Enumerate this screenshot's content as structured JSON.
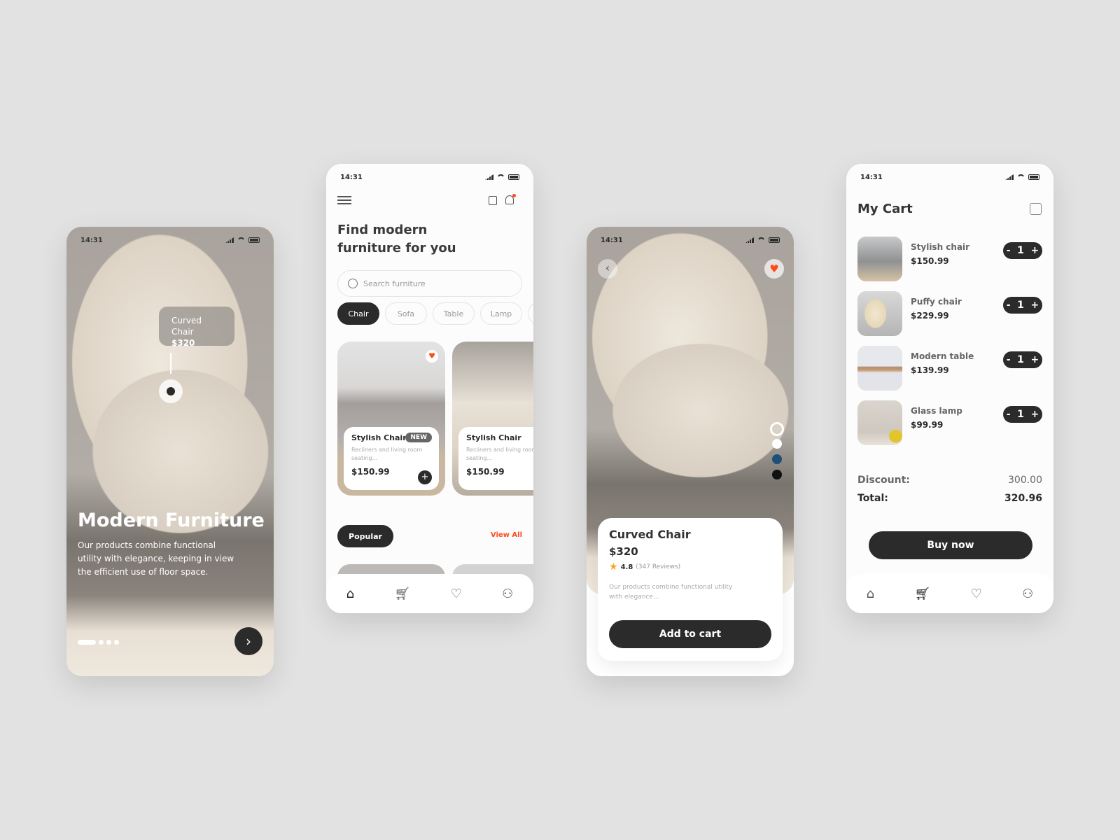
{
  "status_time": "14:31",
  "onboarding": {
    "tag_name": "Curved Chair",
    "tag_price": "$320",
    "title": "Modern Furniture",
    "description": "Our products combine functional utility with elegance, keeping in view the efficient use of floor space.",
    "page_index": 1,
    "page_count": 4
  },
  "home": {
    "title_line1": "Find modern",
    "title_line2": "furniture for you",
    "search_placeholder": "Search furniture",
    "categories": [
      "Chair",
      "Sofa",
      "Table",
      "Lamp"
    ],
    "selected_category": "Chair",
    "products": [
      {
        "name": "Stylish Chair",
        "badge": "NEW",
        "desc": "Recliners and living room seating...",
        "price": "$150.99"
      },
      {
        "name": "Stylish Chair",
        "desc": "Recliners and living room seating...",
        "price": "$150.99"
      }
    ],
    "popular_label": "Popular",
    "view_all": "View All"
  },
  "detail": {
    "name": "Curved Chair",
    "price": "$320",
    "rating": "4.8",
    "reviews": "(347 Reviews)",
    "description": "Our products combine functional utility with elegance...",
    "add_to_cart": "Add to cart",
    "colors": [
      "#d9d2c6",
      "#ffffff",
      "#1f4e79",
      "#111111"
    ]
  },
  "cart": {
    "title": "My Cart",
    "items": [
      {
        "name": "Stylish chair",
        "price": "$150.99",
        "qty": "1"
      },
      {
        "name": "Puffy chair",
        "price": "$229.99",
        "qty": "1"
      },
      {
        "name": "Modern table",
        "price": "$139.99",
        "qty": "1"
      },
      {
        "name": "Glass lamp",
        "price": "$99.99",
        "qty": "1"
      }
    ],
    "discount_label": "Discount:",
    "discount": "300.00",
    "total_label": "Total:",
    "total": "320.96",
    "buy_now": "Buy now"
  },
  "colors": {
    "accent": "#ff4a1c",
    "dark": "#2b2b2b",
    "star": "#f5a623"
  }
}
